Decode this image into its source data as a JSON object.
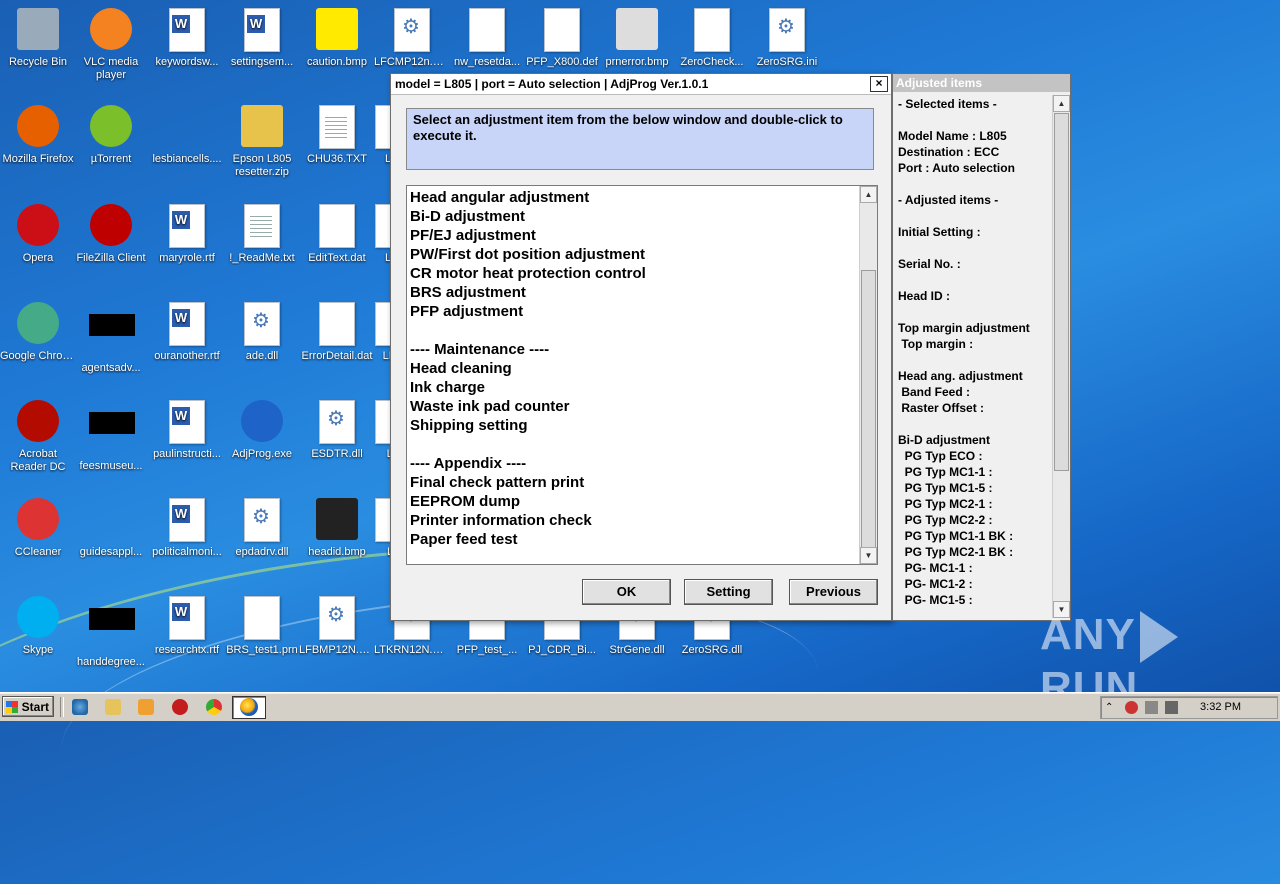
{
  "desktop": {
    "icons": [
      {
        "label": "Recycle Bin",
        "icon": "recycle-bin-icon"
      },
      {
        "label": "VLC media player",
        "icon": "vlc-icon"
      },
      {
        "label": "keywordsw...",
        "icon": "word-doc-icon"
      },
      {
        "label": "settingsem...",
        "icon": "word-doc-icon"
      },
      {
        "label": "caution.bmp",
        "icon": "caution-icon"
      },
      {
        "label": "LFCMP12n.DLL",
        "icon": "dll-icon"
      },
      {
        "label": "nw_resetda...",
        "icon": "file-icon"
      },
      {
        "label": "PFP_X800.def",
        "icon": "file-icon"
      },
      {
        "label": "prnerror.bmp",
        "icon": "printer-error-icon"
      },
      {
        "label": "ZeroCheck...",
        "icon": "file-icon"
      },
      {
        "label": "ZeroSRG.ini",
        "icon": "ini-icon"
      },
      {
        "label": "Mozilla Firefox",
        "icon": "firefox-icon"
      },
      {
        "label": "µTorrent",
        "icon": "utorrent-icon"
      },
      {
        "label": "lesbiancells....",
        "icon": "blank-icon"
      },
      {
        "label": "Epson L805 resetter.zip",
        "icon": "zip-icon"
      },
      {
        "label": "CHU36.TXT",
        "icon": "text-file-icon"
      },
      {
        "label": "LFI",
        "icon": "file-icon"
      },
      {
        "label": "Opera",
        "icon": "opera-icon"
      },
      {
        "label": "FileZilla Client",
        "icon": "filezilla-icon"
      },
      {
        "label": "maryrole.rtf",
        "icon": "word-doc-icon"
      },
      {
        "label": "!_ReadMe.txt",
        "icon": "text-file-icon"
      },
      {
        "label": "EditText.dat",
        "icon": "file-icon"
      },
      {
        "label": "LFI",
        "icon": "file-icon"
      },
      {
        "label": "Google Chrome",
        "icon": "chrome-icon"
      },
      {
        "label": "agentsadv...",
        "icon": "black-thumb-icon"
      },
      {
        "label": "ouranother.rtf",
        "icon": "word-doc-icon"
      },
      {
        "label": "ade.dll",
        "icon": "dll-icon"
      },
      {
        "label": "ErrorDetail.dat",
        "icon": "file-icon"
      },
      {
        "label": "LFR",
        "icon": "file-icon"
      },
      {
        "label": "Acrobat Reader DC",
        "icon": "acrobat-icon"
      },
      {
        "label": "feesmuseu...",
        "icon": "black-thumb-icon"
      },
      {
        "label": "paulinstructi...",
        "icon": "word-doc-icon"
      },
      {
        "label": "AdjProg.exe",
        "icon": "adjprog-icon"
      },
      {
        "label": "ESDTR.dll",
        "icon": "dll-icon"
      },
      {
        "label": "LF",
        "icon": "file-icon"
      },
      {
        "label": "CCleaner",
        "icon": "ccleaner-icon"
      },
      {
        "label": "guidesappl...",
        "icon": "blank-icon"
      },
      {
        "label": "politicalmoni...",
        "icon": "word-doc-icon"
      },
      {
        "label": "epdadrv.dll",
        "icon": "dll-icon"
      },
      {
        "label": "headid.bmp",
        "icon": "image-icon"
      },
      {
        "label": "LT",
        "icon": "file-icon"
      },
      {
        "label": "Skype",
        "icon": "skype-icon"
      },
      {
        "label": "handdegree...",
        "icon": "black-thumb-icon"
      },
      {
        "label": "researchtx.rtf",
        "icon": "word-doc-icon"
      },
      {
        "label": "BRS_test1.prn",
        "icon": "file-icon"
      },
      {
        "label": "LFBMP12N.DLL",
        "icon": "dll-icon"
      },
      {
        "label": "LTKRN12N.DLL",
        "icon": "dll-icon"
      },
      {
        "label": "PFP_test_...",
        "icon": "file-icon"
      },
      {
        "label": "PJ_CDR_Bi...",
        "icon": "file-icon"
      },
      {
        "label": "StrGene.dll",
        "icon": "dll-icon"
      },
      {
        "label": "ZeroSRG.dll",
        "icon": "dll-icon"
      }
    ]
  },
  "adjprog": {
    "title": "model = L805 | port = Auto selection | AdjProg Ver.1.0.1",
    "close_label": "×",
    "instruction": "Select an adjustment item from the below window and double-click to execute it.",
    "items": [
      "Head angular adjustment",
      "Bi-D adjustment",
      "PF/EJ adjustment",
      "PW/First dot position adjustment",
      "CR motor heat protection control",
      "BRS adjustment",
      "PFP adjustment",
      "",
      "---- Maintenance ----",
      "Head cleaning",
      "Ink charge",
      "Waste ink pad counter",
      "Shipping setting",
      "",
      "---- Appendix ----",
      "Final check pattern print",
      "EEPROM dump",
      "Printer information check",
      "Paper feed test"
    ],
    "buttons": {
      "ok": "OK",
      "setting": "Setting",
      "previous": "Previous"
    }
  },
  "adjusted_panel": {
    "title": "Adjusted items",
    "lines": [
      "- Selected items -",
      "",
      "Model Name : L805",
      "Destination : ECC",
      "Port : Auto selection",
      "",
      "- Adjusted items -",
      "",
      "Initial Setting :",
      "",
      "Serial No. :",
      "",
      "Head ID :",
      "",
      "Top margin adjustment",
      " Top margin :",
      "",
      "Head ang. adjustment",
      " Band Feed :",
      " Raster Offset :",
      "",
      "Bi-D adjustment",
      "  PG Typ ECO :",
      "  PG Typ MC1-1 :",
      "  PG Typ MC1-5 :",
      "  PG Typ MC2-1 :",
      "  PG Typ MC2-2 :",
      "  PG Typ MC1-1 BK :",
      "  PG Typ MC2-1 BK :",
      "  PG- MC1-1 :",
      "  PG- MC1-2 :",
      "  PG- MC1-5 :"
    ]
  },
  "taskbar": {
    "start_label": "Start",
    "clock": "3:32 PM"
  },
  "watermark": "ANY RUN"
}
